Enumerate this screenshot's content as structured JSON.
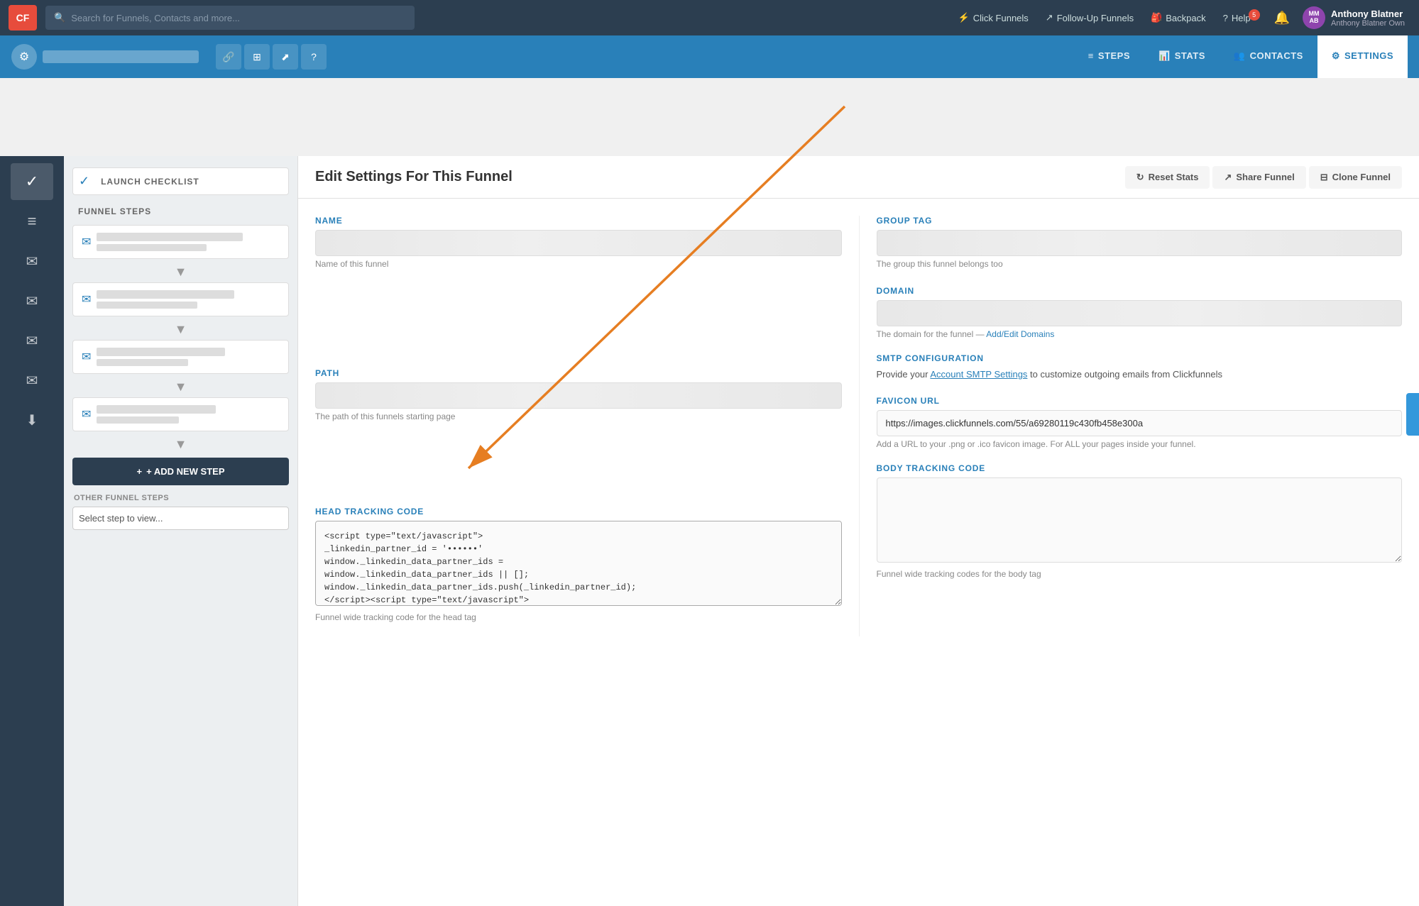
{
  "nav": {
    "logo": "CF",
    "search_placeholder": "Search for Funnels, Contacts and more...",
    "links": [
      {
        "label": "Click Funnels",
        "icon": "⚡"
      },
      {
        "label": "Follow-Up Funnels",
        "icon": "↗"
      },
      {
        "label": "Backpack",
        "icon": "🎒"
      },
      {
        "label": "Help",
        "icon": "?",
        "badge": "5"
      }
    ],
    "user_initials": "MM\nAB",
    "user_name": "Anthony Blatner",
    "user_role": "Anthony Blatner Own"
  },
  "funnel_header": {
    "gear_icon": "⚙",
    "name_placeholder": "Funnel Name Here",
    "tools": [
      "🔗",
      "⊞",
      "⬈",
      "?"
    ],
    "nav_items": [
      {
        "label": "STEPS",
        "icon": "≡",
        "active": false
      },
      {
        "label": "STATS",
        "icon": "📊",
        "active": false
      },
      {
        "label": "CONTACTS",
        "icon": "👥",
        "active": false
      },
      {
        "label": "SETTINGS",
        "icon": "⚙",
        "active": true
      }
    ]
  },
  "sidebar": {
    "icons": [
      {
        "name": "check",
        "symbol": "✓",
        "active": true
      },
      {
        "name": "steps",
        "symbol": "≡",
        "active": false
      },
      {
        "name": "email1",
        "symbol": "✉",
        "active": false
      },
      {
        "name": "email2",
        "symbol": "✉",
        "active": false
      },
      {
        "name": "email3",
        "symbol": "✉",
        "active": false
      },
      {
        "name": "email4",
        "symbol": "✉",
        "active": false
      },
      {
        "name": "download",
        "symbol": "⬇",
        "active": false
      }
    ]
  },
  "steps_panel": {
    "funnel_steps_title": "FUNNEL STEPS",
    "launch_checklist_label": "LAUNCH CHECKLIST",
    "add_step_label": "+ ADD NEW STEP",
    "other_steps_title": "OTHER FUNNEL STEPS",
    "select_placeholder": "Select step to view...",
    "steps": [
      {
        "id": 1
      },
      {
        "id": 2
      },
      {
        "id": 3
      },
      {
        "id": 4
      }
    ]
  },
  "content": {
    "header_title": "Edit Settings For This Funnel",
    "reset_stats_label": "Reset Stats",
    "share_funnel_label": "Share Funnel",
    "clone_funnel_label": "Clone Funnel",
    "name_label": "NAME",
    "name_hint": "Name of this funnel",
    "group_tag_label": "GROUP TAG",
    "group_tag_hint": "The group this funnel belongs too",
    "domain_label": "DOMAIN",
    "domain_hint": "The domain for the funnel — ",
    "domain_link": "Add/Edit Domains",
    "path_label": "PATH",
    "path_hint": "The path of this funnels starting page",
    "smtp_label": "SMTP CONFIGURATION",
    "smtp_text": "Provide your ",
    "smtp_link_text": "Account SMTP Settings",
    "smtp_text2": " to customize outgoing emails from Clickfunnels",
    "favicon_label": "FAVICON URL",
    "favicon_value": "https://images.clickfunnels.com/55/a69280119c430fb458e300a",
    "favicon_hint": "Add a URL to your .png or .ico favicon image. For ALL your pages inside your funnel.",
    "head_tracking_label": "HEAD TRACKING CODE",
    "head_tracking_code": "<script type=\"text/javascript\">\n_linkedin_partner_id = '••••••'\nwindow._linkedin_data_partner_ids =\nwindow._linkedin_data_partner_ids || [];\nwindow._linkedin_data_partner_ids.push(_linkedin_partner_id);\n</script><script type=\"text/javascript\">",
    "head_tracking_hint": "Funnel wide tracking code for the head tag",
    "body_tracking_label": "BODY TRACKING CODE",
    "body_tracking_hint": "Funnel wide tracking codes for the body tag",
    "arrow_from_contacts": "CONTACTS → HEAD TRACKING CODE"
  },
  "colors": {
    "brand_blue": "#2980b9",
    "dark_nav": "#2c3e50",
    "arrow_orange": "#e67e22"
  }
}
